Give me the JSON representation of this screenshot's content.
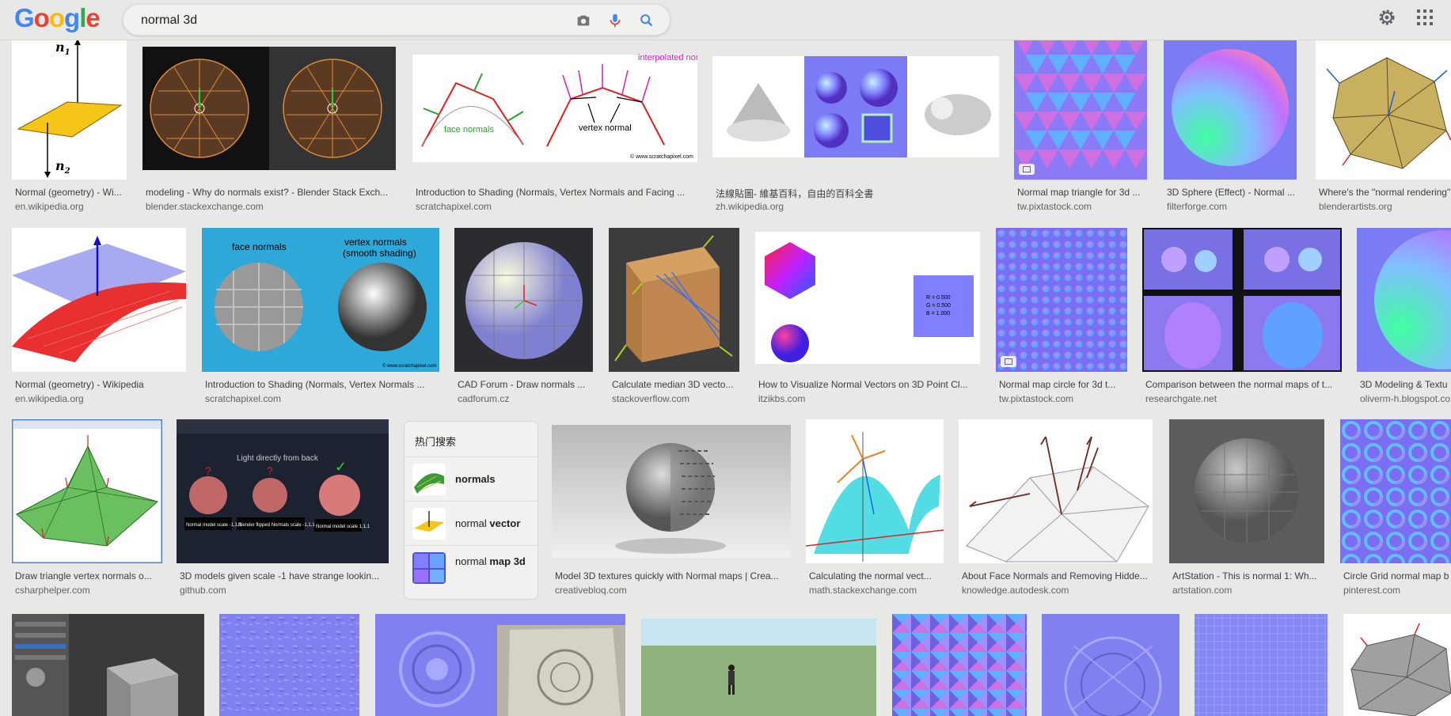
{
  "header": {
    "logo_text": "Google",
    "search_query": "normal 3d"
  },
  "icons": [
    "camera-icon",
    "microphone-icon",
    "search-icon",
    "gear-icon",
    "apps-grid-icon"
  ],
  "colors": {
    "link_blue": "#4285f4",
    "background": "#e8e8e6"
  },
  "results": [
    {
      "title": "Normal (geometry) - Wi...",
      "source": "en.wikipedia.org"
    },
    {
      "title": "modeling - Why do normals exist? - Blender Stack Exch...",
      "source": "blender.stackexchange.com"
    },
    {
      "title": "Introduction to Shading (Normals, Vertex Normals and Facing ...",
      "source": "scratchapixel.com"
    },
    {
      "title": "法線貼圖- 維基百科，自由的百科全書",
      "source": "zh.wikipedia.org"
    },
    {
      "title": "Normal map triangle for 3d ...",
      "source": "tw.pixtastock.com"
    },
    {
      "title": "3D Sphere (Effect) - Normal ...",
      "source": "filterforge.com"
    },
    {
      "title": "Where's the \"normal rendering\"",
      "source": "blenderartists.org"
    },
    {
      "title": "Normal (geometry) - Wikipedia",
      "source": "en.wikipedia.org"
    },
    {
      "title": "Introduction to Shading (Normals, Vertex Normals ...",
      "source": "scratchapixel.com"
    },
    {
      "title": "CAD Forum - Draw normals ...",
      "source": "cadforum.cz"
    },
    {
      "title": "Calculate median 3D vecto...",
      "source": "stackoverflow.com"
    },
    {
      "title": "How to Visualize Normal Vectors on 3D Point Cl...",
      "source": "itzikbs.com"
    },
    {
      "title": "Normal map circle for 3d t...",
      "source": "tw.pixtastock.com"
    },
    {
      "title": "Comparison between the normal maps of t...",
      "source": "researchgate.net"
    },
    {
      "title": "3D Modeling & Textu",
      "source": "oliverm-h.blogspot.co"
    },
    {
      "title": "Draw triangle vertex normals o...",
      "source": "csharphelper.com"
    },
    {
      "title": "3D models given scale -1 have strange lookin...",
      "source": "github.com"
    },
    {
      "title": "Model 3D textures quickly with Normal maps | Crea...",
      "source": "creativebloq.com"
    },
    {
      "title": "Calculating the normal vect...",
      "source": "math.stackexchange.com"
    },
    {
      "title": "About Face Normals and Removing Hidde...",
      "source": "knowledge.autodesk.com"
    },
    {
      "title": "ArtStation - This is normal 1: Wh...",
      "source": "artstation.com"
    },
    {
      "title": "Circle Grid normal map b",
      "source": "pinterest.com"
    }
  ],
  "thumb_text": {
    "n1": "n",
    "n1_sub": "1",
    "n2": "n",
    "n2_sub": "2",
    "interpolated_normals": "interpolated normals",
    "face_normals": "face normals",
    "vertex_normal": "vertex normal",
    "scratchapixel_credit": "© www.scratchapixel.com",
    "face_normals_2": "face normals",
    "vertex_normals_2": "vertex normals",
    "smooth_shading": "(smooth shading)",
    "rgb_r": "R = 0.500",
    "rgb_g": "G = 0.500",
    "rgb_b": "B = 1.000",
    "light_directly": "Light directly from back",
    "normal_model_a": "Normal model scale -1,1,1",
    "blender_flipped": "Blender flipped Normals scale -1,1,1",
    "normal_model_b": "Normal model scale 1,1,1"
  },
  "popular_searches": {
    "heading": "热门搜索",
    "items": [
      {
        "base": "",
        "bold": "normals"
      },
      {
        "base": "normal ",
        "bold": "vector"
      },
      {
        "base": "normal ",
        "bold": "map 3d"
      }
    ]
  }
}
